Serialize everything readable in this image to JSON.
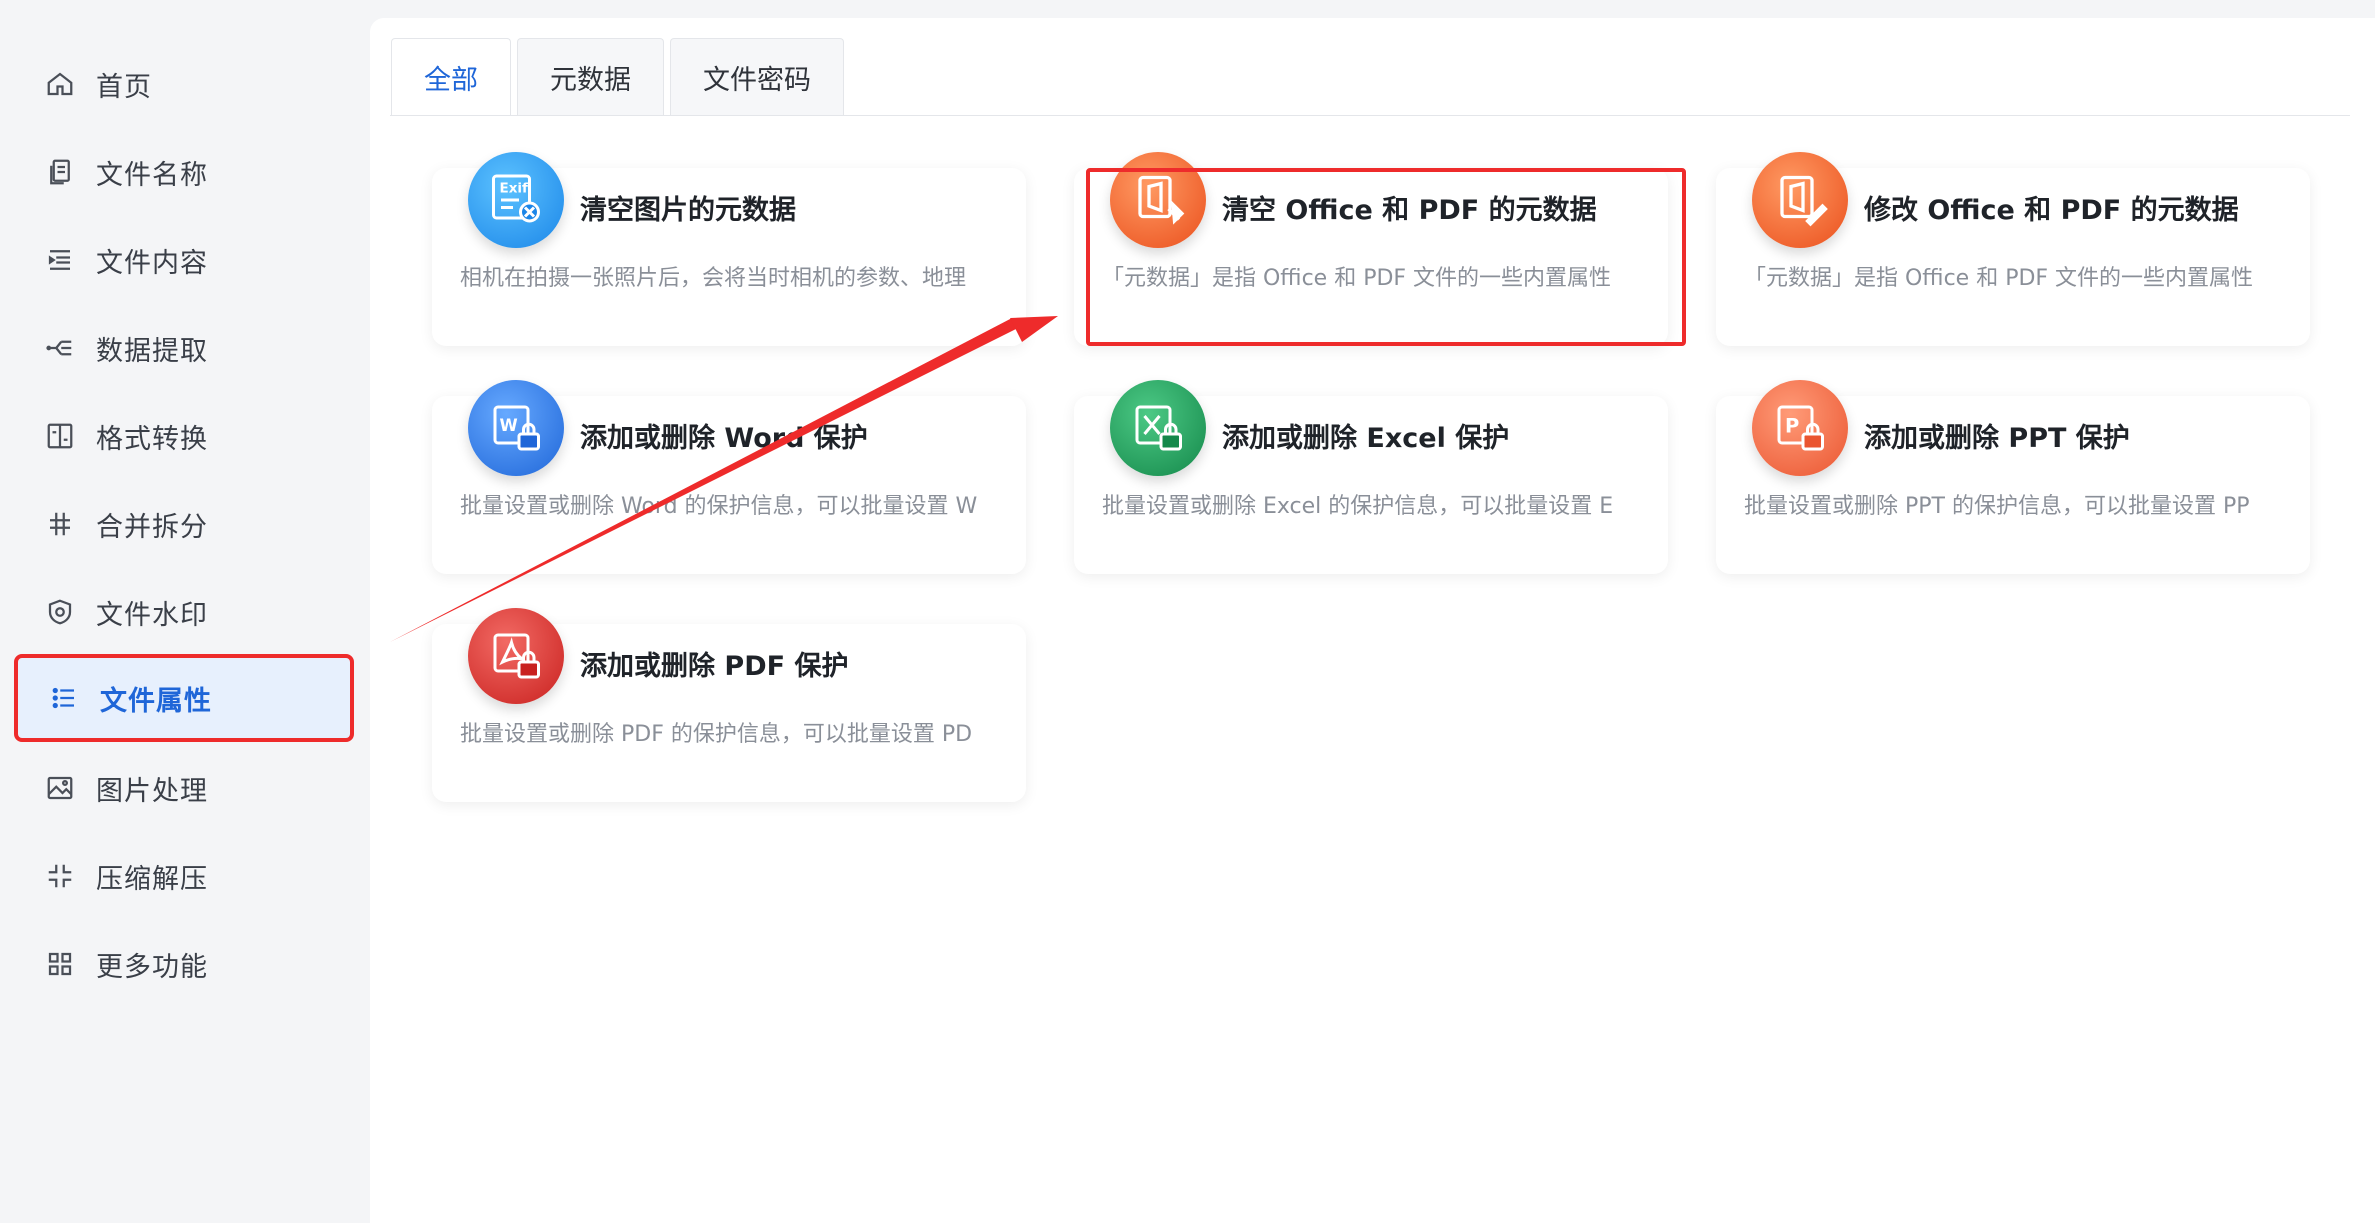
{
  "sidebar": {
    "items": [
      {
        "label": "首页",
        "icon": "home-icon"
      },
      {
        "label": "文件名称",
        "icon": "file-copy-icon"
      },
      {
        "label": "文件内容",
        "icon": "indent-list-icon"
      },
      {
        "label": "数据提取",
        "icon": "extract-icon"
      },
      {
        "label": "格式转换",
        "icon": "convert-icon"
      },
      {
        "label": "合并拆分",
        "icon": "hash-icon"
      },
      {
        "label": "文件水印",
        "icon": "watermark-shield-icon"
      },
      {
        "label": "文件属性",
        "icon": "list-icon"
      },
      {
        "label": "图片处理",
        "icon": "image-icon"
      },
      {
        "label": "压缩解压",
        "icon": "compress-icon"
      },
      {
        "label": "更多功能",
        "icon": "grid-icon"
      }
    ],
    "active_index": 7
  },
  "tabs": [
    {
      "label": "全部"
    },
    {
      "label": "元数据"
    },
    {
      "label": "文件密码"
    }
  ],
  "active_tab": 0,
  "cards": [
    {
      "title": "清空图片的元数据",
      "desc": "相机在拍摄一张照片后，会将当时相机的参数、地理",
      "badge_text": "Exif",
      "color": "#2a9df4"
    },
    {
      "title": "清空 Office 和 PDF 的元数据",
      "desc": "「元数据」是指 Office 和 PDF 文件的一些内置属性",
      "color": "#f2632a"
    },
    {
      "title": "修改 Office 和 PDF 的元数据",
      "desc": "「元数据」是指 Office 和 PDF 文件的一些内置属性",
      "color": "#f2632a"
    },
    {
      "title": "添加或删除 Word 保护",
      "desc": "批量设置或删除 Word 的保护信息，可以批量设置 W",
      "color": "#2f7de8"
    },
    {
      "title": "添加或删除 Excel 保护",
      "desc": "批量设置或删除 Excel 的保护信息，可以批量设置 E",
      "color": "#1f9d5b"
    },
    {
      "title": "添加或删除 PPT 保护",
      "desc": "批量设置或删除 PPT 的保护信息，可以批量设置 PP",
      "color": "#f26b45"
    },
    {
      "title": "添加或删除 PDF 保护",
      "desc": "批量设置或删除 PDF 的保护信息，可以批量设置 PD",
      "color": "#e03a36"
    }
  ],
  "colors": {
    "accent": "#1f66d8",
    "highlight": "#ee2b2b"
  }
}
